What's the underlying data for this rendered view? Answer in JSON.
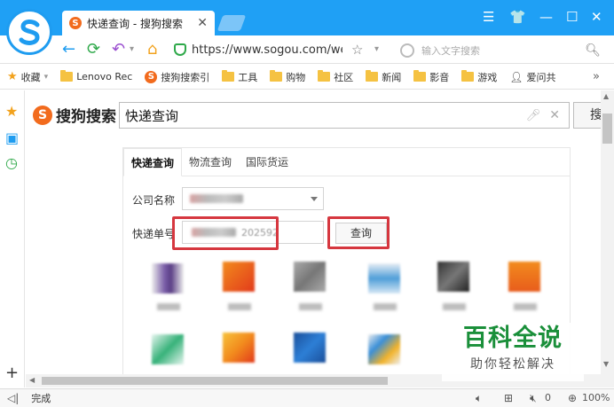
{
  "browser": {
    "tab_title": "快递查询 - 搜狗搜索",
    "url": "https://www.sogou.com/we",
    "search_placeholder": "输入文字搜索",
    "status_text": "完成",
    "sound_count": "0",
    "zoom": "100%",
    "accent_color": "#1fa0f5"
  },
  "bookmarks": [
    {
      "label": "收藏",
      "icon": "star-icon"
    },
    {
      "label": "Lenovo Rec",
      "icon": "folder-icon"
    },
    {
      "label": "搜狗搜索引",
      "icon": "sogou-icon"
    },
    {
      "label": "工具",
      "icon": "folder-icon"
    },
    {
      "label": "购物",
      "icon": "folder-icon"
    },
    {
      "label": "社区",
      "icon": "folder-icon"
    },
    {
      "label": "新闻",
      "icon": "folder-icon"
    },
    {
      "label": "影音",
      "icon": "folder-icon"
    },
    {
      "label": "游戏",
      "icon": "folder-icon"
    },
    {
      "label": "爱问共",
      "icon": "user-icon"
    }
  ],
  "page": {
    "brand": "搜狗搜索",
    "query": "快递查询",
    "search_button": "搜",
    "tabs": [
      "快递查询",
      "物流查询",
      "国际货运"
    ],
    "company_label": "公司名称",
    "number_label": "快递单号",
    "number_value_visible": "202592",
    "query_button": "查询"
  },
  "watermark": {
    "big": "百科全说",
    "small": "助你轻松解决"
  }
}
